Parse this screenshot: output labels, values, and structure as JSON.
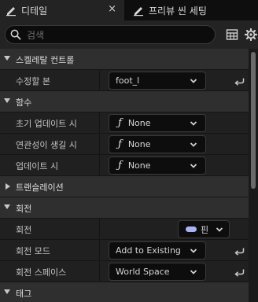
{
  "tabs": [
    {
      "label": "디테일",
      "icon": "details-icon",
      "close": "×"
    },
    {
      "label": "프리뷰 씬 세팅",
      "icon": "preview-scene-settings-icon"
    }
  ],
  "search": {
    "placeholder": "검색"
  },
  "toolbar": {
    "icons": [
      "grid-view-icon",
      "settings-gear-icon"
    ]
  },
  "categories": {
    "skeletal_control": "스켈레탈 컨트롤",
    "functions": "함수",
    "translation": "트랜슬레이션",
    "rotation": "회전",
    "tag": "태그"
  },
  "properties": {
    "bone_to_modify": {
      "label": "수정할 본",
      "value": "foot_l"
    },
    "initial_update": {
      "label": "초기 업데이트 시",
      "value": "None"
    },
    "became_relevant": {
      "label": "연관성이 생길 시",
      "value": "None"
    },
    "on_update": {
      "label": "업데이트 시",
      "value": "None"
    },
    "rotation": {
      "label": "회전",
      "value": "핀"
    },
    "rotation_mode": {
      "label": "회전 모드",
      "value": "Add to Existing"
    },
    "rotation_space": {
      "label": "회전 스페이스",
      "value": "World Space"
    }
  },
  "colors": {
    "pin": "#a7b3f2",
    "background": "#1a1a1a",
    "category": "#2f2f2f"
  }
}
